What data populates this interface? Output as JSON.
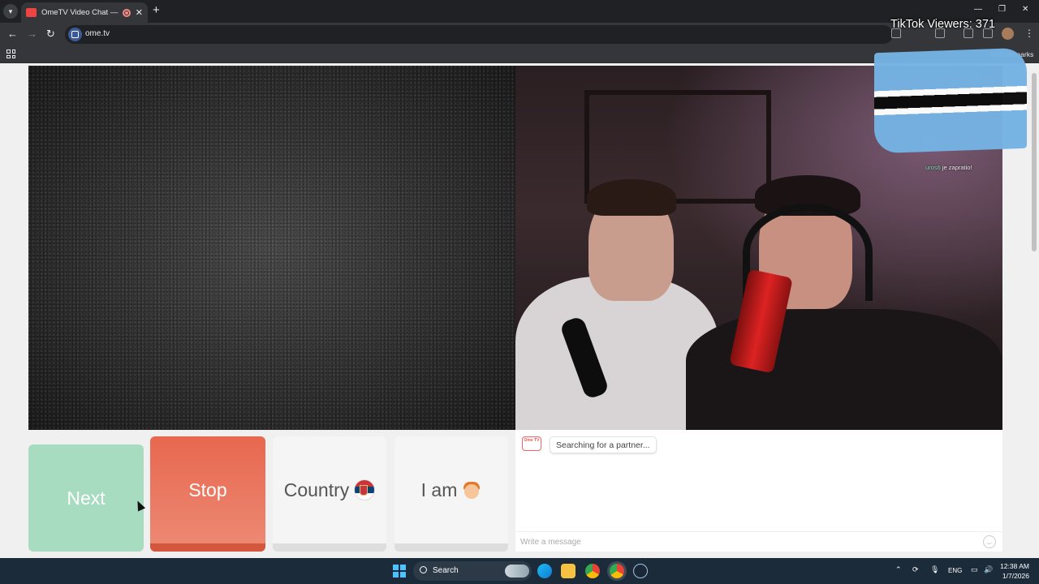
{
  "browser": {
    "tab_title": "OmeTV Video Chat — Ome",
    "url": "ome.tv",
    "bookmarks_label": "All Bookmarks"
  },
  "overlay": {
    "tiktok_viewers": "TikTok Viewers: 371",
    "flag_note_user": "uros6",
    "flag_note_text": " je zapratio!"
  },
  "controls": {
    "next_label": "Next",
    "stop_label": "Stop",
    "country_label": "Country",
    "iam_label": "I am"
  },
  "chat": {
    "status_message": "Searching for a partner...",
    "input_placeholder": "Write a message",
    "logo_text": "Ome TV"
  },
  "taskbar": {
    "search_label": "Search",
    "language": "ENG",
    "time": "12:38 AM",
    "date": "1/7/2026"
  },
  "colors": {
    "next": "#a8dcc0",
    "stop": "#e8674f",
    "taskbar": "#1c2b3a"
  }
}
